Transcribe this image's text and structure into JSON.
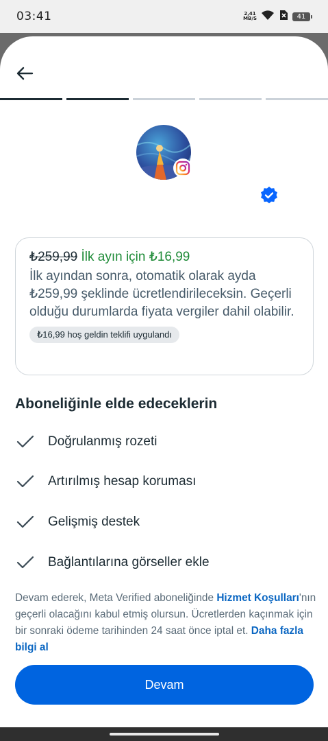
{
  "status_bar": {
    "time": "03:41",
    "net_speed_value": "2,41",
    "net_speed_unit": "MB/S",
    "battery": "41"
  },
  "progress": {
    "total_steps": 5,
    "completed_steps": 2
  },
  "colors": {
    "primary": "#0064e0",
    "promo_green": "#1d8a36",
    "link_blue": "#0a66c2",
    "verified_blue": "#0866ff"
  },
  "offer": {
    "old_price": "₺259,99",
    "promo_text": "İlk ayın için ₺16,99",
    "description": "İlk ayından sonra, otomatik olarak ayda ₺259,99 şeklinde ücretlendirileceksin. Geçerli olduğu durumlarda fiyata vergiler dahil olabilir.",
    "chip": "₺16,99 hoş geldin teklifi uygulandı"
  },
  "benefits": {
    "title": "Aboneliğinle elde edeceklerin",
    "items": [
      "Doğrulanmış rozeti",
      "Artırılmış hesap koruması",
      "Gelişmiş destek",
      "Bağlantılarına görseller ekle"
    ]
  },
  "terms": {
    "text_before": "Devam ederek, Meta Verified aboneliğinde ",
    "terms_link": "Hizmet Koşulları",
    "text_middle": "'nın geçerli olacağını kabul etmiş olursun. Ücretlerden kaçınmak için bir sonraki ödeme tarihinden 24 saat önce iptal et. ",
    "learn_more_link": "Daha fazla bilgi al"
  },
  "continue_button": "Devam",
  "icons": {
    "back": "arrow-left-icon",
    "verified": "verified-badge-icon",
    "instagram": "instagram-icon",
    "check": "check-icon"
  }
}
